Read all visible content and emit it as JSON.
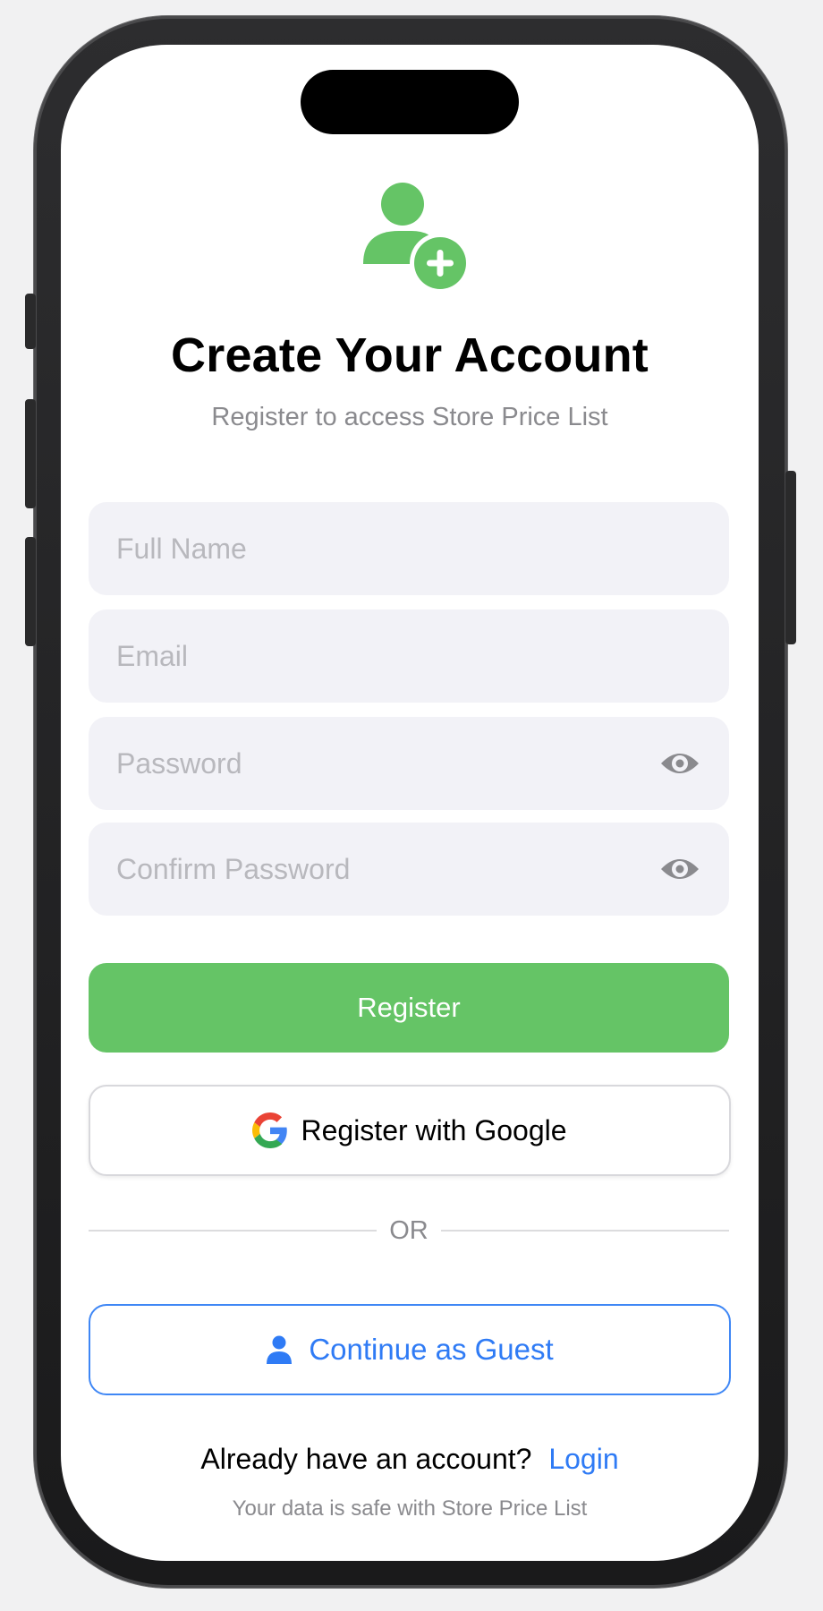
{
  "header": {
    "icon": "person-add-icon",
    "title": "Create Your Account",
    "subtitle": "Register to access Store Price List"
  },
  "form": {
    "full_name_placeholder": "Full Name",
    "email_placeholder": "Email",
    "password_placeholder": "Password",
    "confirm_password_placeholder": "Confirm Password",
    "reveal_icon": "eye-icon"
  },
  "actions": {
    "register_label": "Register",
    "google_label": "Register with Google",
    "divider_label": "OR",
    "guest_label": "Continue as Guest"
  },
  "login": {
    "prompt": "Already have an account?",
    "link_label": "Login"
  },
  "footer": {
    "text": "Your data is safe with Store Price List"
  },
  "colors": {
    "accent_green": "#65c466",
    "link_blue": "#2f7bf5",
    "field_bg": "#f2f2f7",
    "placeholder": "#b8b8bd",
    "secondary_text": "#8a8a8e"
  }
}
